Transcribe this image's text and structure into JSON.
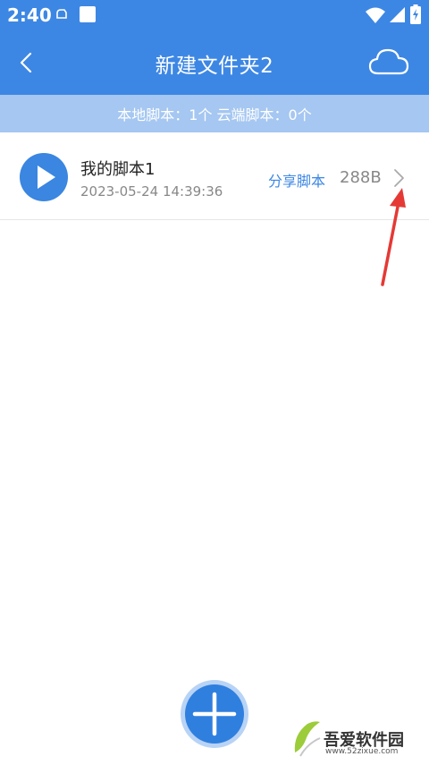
{
  "status_bar": {
    "time": "2:40",
    "icons": [
      "cloud-sync-icon",
      "square-notification-icon",
      "wifi-icon",
      "signal-icon",
      "battery-icon"
    ]
  },
  "header": {
    "title": "新建文件夹2",
    "back_icon": "chevron-left-icon",
    "action_icon": "cloud-icon"
  },
  "summary": {
    "text": "本地脚本：1个 云端脚本：0个"
  },
  "scripts": [
    {
      "name": "我的脚本1",
      "timestamp": "2023-05-24 14:39:36",
      "share_label": "分享脚本",
      "size": "288B"
    }
  ],
  "fab": {
    "icon": "plus-icon"
  },
  "watermark": {
    "text": "吾爱软件园",
    "url": "www.52zixue.com"
  },
  "colors": {
    "primary": "#3d87e4",
    "summary_bg": "#a5c7f1",
    "annotation": "#e53935"
  }
}
